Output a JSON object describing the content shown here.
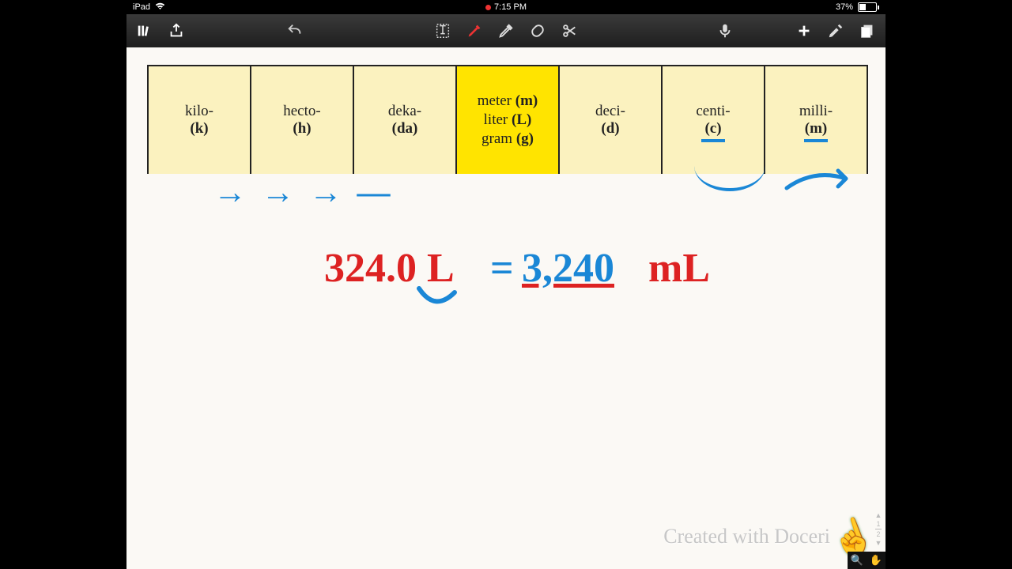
{
  "status": {
    "device": "iPad",
    "time": "7:15 PM",
    "battery_pct": "37%"
  },
  "toolbar": {
    "library": "library",
    "share": "share",
    "undo": "undo",
    "text": "text",
    "pen": "pen",
    "highlighter": "highlighter",
    "eraser": "eraser",
    "scissors": "scissors",
    "mic": "mic",
    "add": "add",
    "wrench": "settings",
    "pages": "pages"
  },
  "table": {
    "cells": [
      {
        "prefix": "kilo-",
        "abbr": "(k)"
      },
      {
        "prefix": "hecto-",
        "abbr": "(h)"
      },
      {
        "prefix": "deka-",
        "abbr": "(da)"
      },
      {
        "base": [
          {
            "u": "meter",
            "a": "(m)"
          },
          {
            "u": "liter",
            "a": "(L)"
          },
          {
            "u": "gram",
            "a": "(g)"
          }
        ]
      },
      {
        "prefix": "deci-",
        "abbr": "(d)"
      },
      {
        "prefix": "centi-",
        "abbr": "(c)"
      },
      {
        "prefix": "milli-",
        "abbr": "(m)"
      }
    ]
  },
  "handwriting": {
    "arrows": "→  →  →  —",
    "lhs": "324.0 L",
    "eq": "=",
    "rhs_num": "3,240",
    "rhs_unit": "mL"
  },
  "watermark": "Created with Doceri",
  "scroll": {
    "pos": "1",
    "total": "2"
  }
}
